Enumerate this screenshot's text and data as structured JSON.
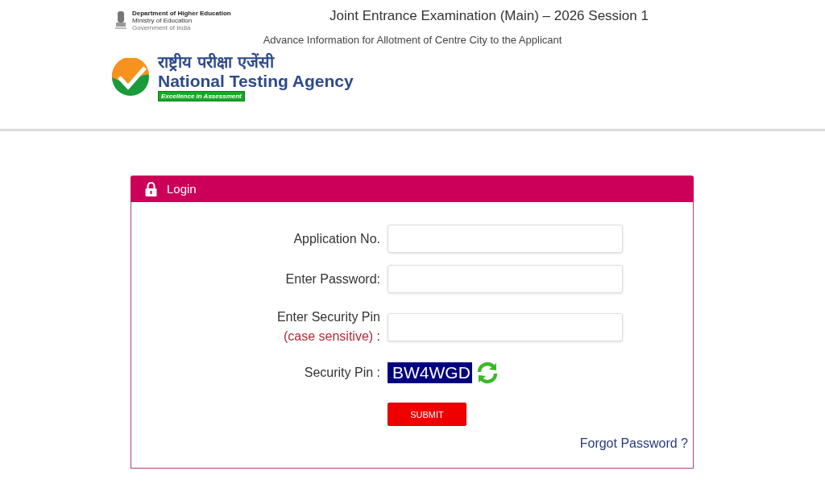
{
  "ministry": {
    "line1": "Department of Higher Education",
    "line2": "Ministry of Education",
    "line3": "Government of India"
  },
  "exam_title": "Joint Entrance Examination (Main) – 2026 Session 1",
  "subtitle": "Advance Information for Allotment of Centre City to the Applicant",
  "agency": {
    "hindi": "राष्ट्रीय परीक्षा एजेंसी",
    "name": "National Testing Agency",
    "tagline": "Excellence in Assessment"
  },
  "login": {
    "title": "Login",
    "fields": [
      {
        "label": "Application No."
      },
      {
        "label": "Enter Password:"
      },
      {
        "label": "Enter Security Pin",
        "note": "(case sensitive)",
        "suffix": " :"
      }
    ],
    "pin_label": "Security Pin :",
    "pin": "BW4WGD",
    "submit": "SUBMIT",
    "forgot": "Forgot Password ?"
  }
}
